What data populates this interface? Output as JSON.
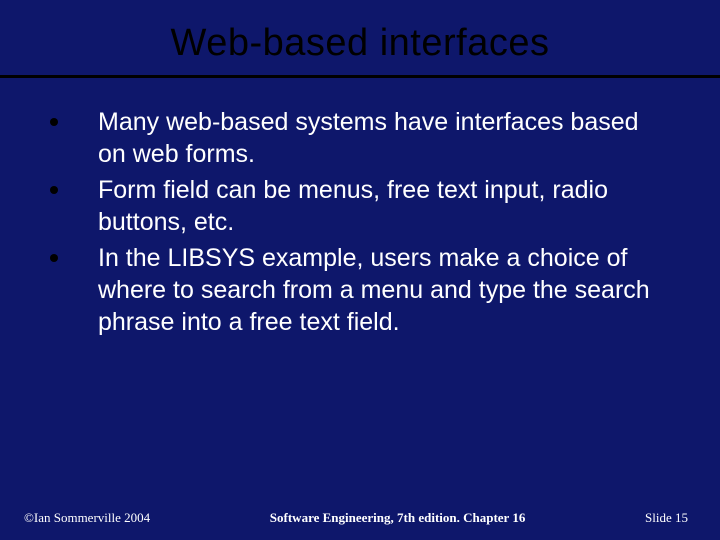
{
  "title": "Web-based interfaces",
  "bullets": [
    "Many web-based systems have interfaces based on web forms.",
    "Form field can be menus, free text input, radio buttons, etc.",
    "In the LIBSYS example, users make a choice of where to search from a menu and type the search phrase into a free text field."
  ],
  "footer": {
    "left": "©Ian Sommerville 2004",
    "center": "Software Engineering, 7th edition. Chapter 16",
    "right_label": "Slide",
    "right_number": "15"
  }
}
